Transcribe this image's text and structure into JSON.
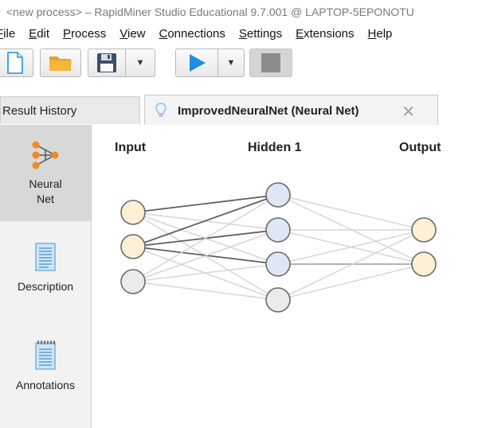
{
  "window": {
    "title": "<new process> – RapidMiner Studio Educational 9.7.001 @ LAPTOP-5EPONOTU"
  },
  "menu": [
    {
      "first": "F",
      "rest": "ile"
    },
    {
      "first": "E",
      "rest": "dit"
    },
    {
      "first": "P",
      "rest": "rocess"
    },
    {
      "first": "V",
      "rest": "iew"
    },
    {
      "first": "C",
      "rest": "onnections"
    },
    {
      "first": "S",
      "rest": "ettings"
    },
    {
      "first": "",
      "ul": "E",
      "rest2": "xtensions",
      "label": "Extensions"
    },
    {
      "first": "H",
      "rest": "elp"
    }
  ],
  "toolbar": {
    "buttons": [
      "new-process",
      "open-process",
      "save-process",
      "run-process",
      "stop-process"
    ]
  },
  "tabs": {
    "history_label": "Result History",
    "active_label": "ImprovedNeuralNet (Neural Net)",
    "close_glyph": "✕"
  },
  "sidebar": {
    "items": [
      {
        "label_line1": "Neural",
        "label_line2": "Net",
        "selected": true
      },
      {
        "label_line1": "Description",
        "label_line2": ""
      },
      {
        "label_line1": "Annotations",
        "label_line2": ""
      }
    ]
  },
  "network": {
    "layers": [
      {
        "title": "Input",
        "nodes": 3,
        "color": "#fbefd5"
      },
      {
        "title": "Hidden 1",
        "nodes": 4,
        "color": "#dfe6f4"
      },
      {
        "title": "Output",
        "nodes": 2,
        "color": "#fbefd5"
      }
    ],
    "input_alt_color": "#ebebeb",
    "dark_edges": [
      [
        1,
        0
      ],
      [
        0,
        0
      ],
      [
        1,
        1
      ],
      [
        1,
        2
      ]
    ],
    "medium_edges": [
      [
        2,
        1
      ],
      [
        6,
        1
      ]
    ]
  },
  "colors": {
    "accent_blue": "#1f8ee0",
    "folder_yellow": "#f4b73a",
    "node_stroke": "#6a6a6a"
  }
}
